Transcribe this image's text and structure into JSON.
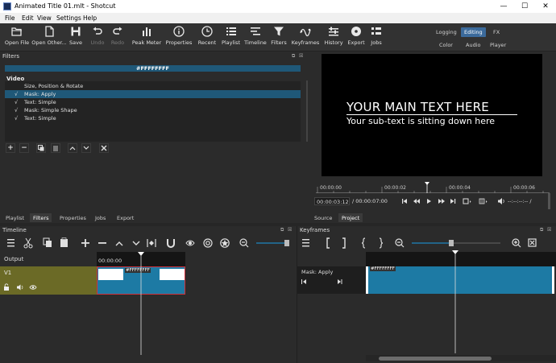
{
  "window": {
    "title": "Animated Title 01.mlt - Shotcut",
    "minimize": "—",
    "maximize": "☐",
    "close": "✕"
  },
  "menu": [
    "File",
    "Edit",
    "View",
    "Settings",
    "Help"
  ],
  "toolbar": {
    "open_file": "Open File",
    "open_other": "Open Other...",
    "save": "Save",
    "undo": "Undo",
    "redo": "Redo",
    "peak_meter": "Peak Meter",
    "properties": "Properties",
    "recent": "Recent",
    "playlist": "Playlist",
    "timeline": "Timeline",
    "filters": "Filters",
    "keyframes": "Keyframes",
    "history": "History",
    "export": "Export",
    "jobs": "Jobs"
  },
  "layouts": {
    "logging": "Logging",
    "editing": "Editing",
    "fx": "FX",
    "color": "Color",
    "audio": "Audio",
    "player": "Player"
  },
  "filters_panel": {
    "title": "Filters",
    "color_value": "#FFFFFFFF",
    "group": "Video",
    "items": [
      {
        "checked": false,
        "label": "Size, Position & Rotate"
      },
      {
        "checked": true,
        "label": "Mask: Apply"
      },
      {
        "checked": true,
        "label": "Text: Simple"
      },
      {
        "checked": true,
        "label": "Mask: Simple Shape"
      },
      {
        "checked": true,
        "label": "Text: Simple"
      }
    ],
    "check_glyph": "√"
  },
  "left_tabs": [
    "Playlist",
    "Filters",
    "Properties",
    "Jobs",
    "Export"
  ],
  "player": {
    "main_text": "YOUR MAIN TEXT HERE",
    "sub_text": "Your sub-text is sitting down here",
    "ruler_labels": [
      "00:00:00",
      "00:00:02",
      "00:00:04",
      "00:00:06"
    ],
    "current_time": "00:00:03:12",
    "duration": "/ 00:00:07:00",
    "in_out": "--:--:--:-- /"
  },
  "right_tabs": [
    "Source",
    "Project"
  ],
  "timeline": {
    "title": "Timeline",
    "output_label": "Output",
    "ruler_label": "00:00:00",
    "track_name": "V1",
    "clip_label": "#FFFFFFFF"
  },
  "keyframes": {
    "title": "Keyframes",
    "track_label": "Mask: Apply",
    "clip_label": "#FFFFFFFF"
  },
  "colors": {
    "accent": "#1f5878",
    "track_header": "#6b6a26",
    "clip": "#1d7aa4",
    "selection_border": "#d0303a"
  }
}
